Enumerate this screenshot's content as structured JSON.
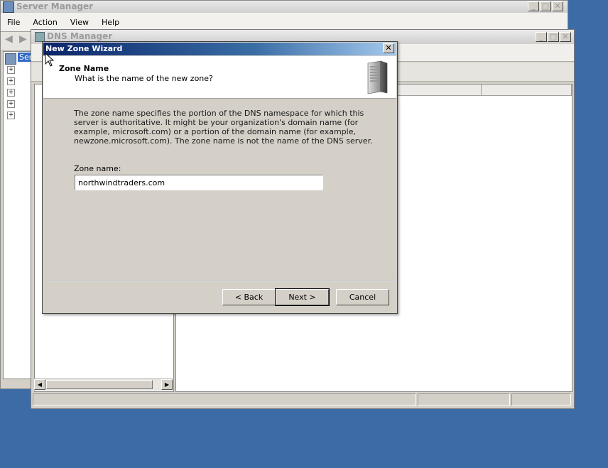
{
  "server_manager": {
    "title": "Server Manager",
    "menu": [
      "File",
      "Action",
      "View",
      "Help"
    ],
    "tree_item_label": "Ser",
    "buttons": {
      "minimize": "_",
      "maximize": "□",
      "close": "✕"
    }
  },
  "dns_manager": {
    "title": "DNS Manager",
    "buttons": {
      "minimize": "_",
      "maximize": "□",
      "close": "✕"
    }
  },
  "wizard": {
    "title": "New Zone Wizard",
    "close": "✕",
    "heading": "Zone Name",
    "subheading": "What is the name of the new zone?",
    "description": "The zone name specifies the portion of the DNS namespace for which this server is authoritative. It might be your organization's domain name (for example,  microsoft.com) or a portion of the domain name (for example, newzone.microsoft.com). The zone name is not the name of the DNS server.",
    "zone_label": "Zone name:",
    "zone_value": "northwindtraders.com",
    "back": "< Back",
    "next": "Next >",
    "cancel": "Cancel"
  },
  "icons": [
    "server-tower-icon",
    "expand-plus-icon",
    "scroll-left-icon",
    "scroll-right-icon",
    "back-arrow-icon",
    "forward-arrow-icon"
  ]
}
